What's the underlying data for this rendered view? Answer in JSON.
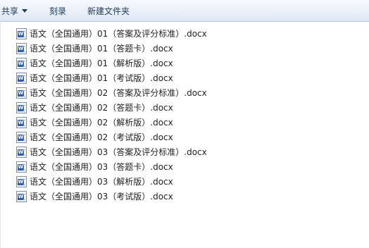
{
  "toolbar": {
    "share_label": "共享",
    "burn_label": "刻录",
    "new_folder_label": "新建文件夹"
  },
  "files": [
    {
      "name": "语文（全国通用）01（答案及评分标准）.docx",
      "icon": "word-doc-icon"
    },
    {
      "name": "语文（全国通用）01（答题卡）.docx",
      "icon": "word-doc-icon"
    },
    {
      "name": "语文（全国通用）01（解析版）.docx",
      "icon": "word-doc-icon"
    },
    {
      "name": "语文（全国通用）01（考试版）.docx",
      "icon": "word-doc-icon"
    },
    {
      "name": "语文（全国通用）02（答案及评分标准）.docx",
      "icon": "word-doc-icon"
    },
    {
      "name": "语文（全国通用）02（答题卡）.docx",
      "icon": "word-doc-icon"
    },
    {
      "name": "语文（全国通用）02（解析版）.docx",
      "icon": "word-doc-icon"
    },
    {
      "name": "语文（全国通用）02（考试版）.docx",
      "icon": "word-doc-icon"
    },
    {
      "name": "语文（全国通用）03（答案及评分标准）.docx",
      "icon": "word-doc-icon"
    },
    {
      "name": "语文（全国通用）03（答题卡）.docx",
      "icon": "word-doc-icon"
    },
    {
      "name": "语文（全国通用）03（解析版）.docx",
      "icon": "word-doc-icon"
    },
    {
      "name": "语文（全国通用）03（考试版）.docx",
      "icon": "word-doc-icon"
    }
  ],
  "colors": {
    "toolbar_text": "#1e395b",
    "word_icon": "#2b5fb4"
  }
}
